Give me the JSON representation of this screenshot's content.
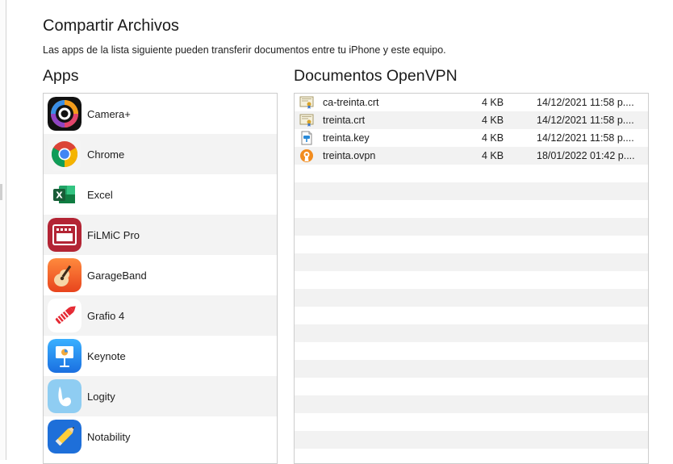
{
  "page": {
    "title": "Compartir Archivos",
    "subtitle": "Las apps de la lista siguiente pueden transferir documentos entre tu iPhone y este equipo."
  },
  "apps": {
    "heading": "Apps",
    "items": [
      {
        "label": "Camera+",
        "icon": "camera-plus-icon"
      },
      {
        "label": "Chrome",
        "icon": "chrome-icon"
      },
      {
        "label": "Excel",
        "icon": "excel-icon"
      },
      {
        "label": "FiLMiC Pro",
        "icon": "filmic-pro-icon"
      },
      {
        "label": "GarageBand",
        "icon": "garageband-icon"
      },
      {
        "label": "Grafio 4",
        "icon": "grafio-icon"
      },
      {
        "label": "Keynote",
        "icon": "keynote-icon"
      },
      {
        "label": "Logity",
        "icon": "logity-icon"
      },
      {
        "label": "Notability",
        "icon": "notability-icon"
      }
    ]
  },
  "documents": {
    "heading": "Documentos OpenVPN",
    "items": [
      {
        "name": "ca-treinta.crt",
        "size": "4 KB",
        "date": "14/12/2021 11:58 p....",
        "icon": "certificate-icon"
      },
      {
        "name": "treinta.crt",
        "size": "4 KB",
        "date": "14/12/2021 11:58 p....",
        "icon": "certificate-icon"
      },
      {
        "name": "treinta.key",
        "size": "4 KB",
        "date": "14/12/2021 11:58 p....",
        "icon": "key-file-icon"
      },
      {
        "name": "treinta.ovpn",
        "size": "4 KB",
        "date": "18/01/2022 01:42 p....",
        "icon": "openvpn-icon"
      }
    ]
  }
}
